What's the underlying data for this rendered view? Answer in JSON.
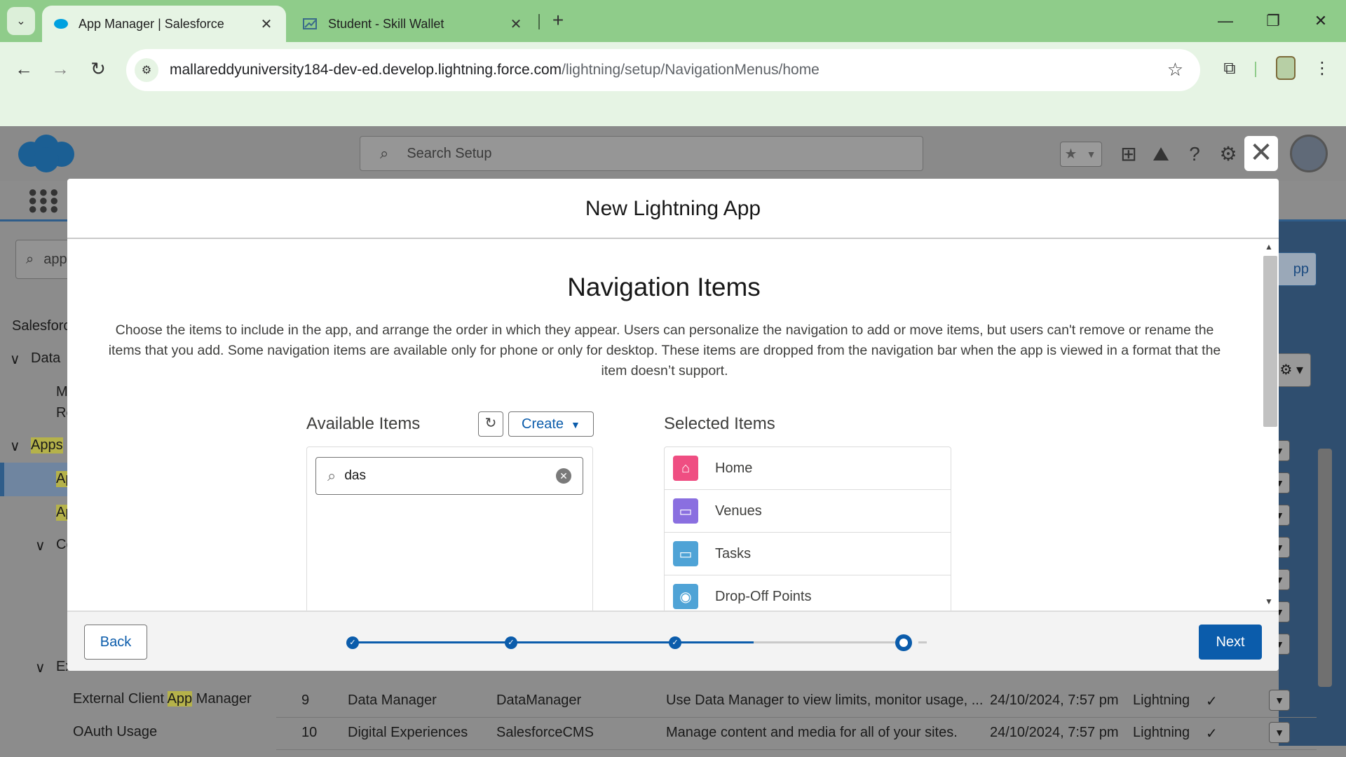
{
  "browser": {
    "tabs": [
      {
        "title": "App Manager | Salesforce",
        "active": true
      },
      {
        "title": "Student - Skill Wallet",
        "active": false
      }
    ],
    "url_host": "mallareddyuniversity184-dev-ed.develop.lightning.force.com",
    "url_path": "/lightning/setup/NavigationMenus/home"
  },
  "setup": {
    "search_placeholder": "Search Setup",
    "sidebar": {
      "search_value": "app",
      "salesforce_text": "Salesforce",
      "data_label": "Data",
      "data_sub1": "M",
      "data_sub2": "Re",
      "apps_label": "Apps",
      "apps_sub1": "Ap",
      "apps_sub2": "Ap",
      "connected_label": "Co",
      "external_label": "Ex",
      "external_client_pre": "External Client ",
      "external_client_hl": "App",
      "external_client_post": " Manager",
      "oauth_usage": "OAuth Usage"
    },
    "new_app_button_fragment": "pp",
    "table_rows": [
      {
        "num": "9",
        "label": "Data Manager",
        "dev_name": "DataManager",
        "description": "Use Data Manager to view limits, monitor usage, ...",
        "modified": "24/10/2024, 7:57 pm",
        "type": "Lightning",
        "visible": "✓"
      },
      {
        "num": "10",
        "label": "Digital Experiences",
        "dev_name": "SalesforceCMS",
        "description": "Manage content and media for all of your sites.",
        "modified": "24/10/2024, 7:57 pm",
        "type": "Lightning",
        "visible": "✓"
      }
    ]
  },
  "modal": {
    "title": "New Lightning App",
    "step_title": "Navigation Items",
    "description": "Choose the items to include in the app, and arrange the order in which they appear. Users can personalize the navigation to add or move items, but users can't remove or rename the items that you add. Some navigation items are available only for phone or only for desktop. These items are dropped from the navigation bar when the app is viewed in a format that the item doesn’t support.",
    "available_label": "Available Items",
    "create_label": "Create",
    "filter_value": "das",
    "selected_label": "Selected Items",
    "selected_items": [
      {
        "label": "Home",
        "icon": "home-icon",
        "color": "#ef4e82"
      },
      {
        "label": "Venues",
        "icon": "monitor-icon",
        "color": "#8a6fe0"
      },
      {
        "label": "Tasks",
        "icon": "laptop-icon",
        "color": "#4fa3d6"
      },
      {
        "label": "Drop-Off Points",
        "icon": "camera-icon",
        "color": "#4fa3d6"
      }
    ],
    "back_label": "Back",
    "next_label": "Next",
    "progress": {
      "total_steps": 5,
      "completed_steps": 3,
      "current_step": 4
    }
  },
  "colors": {
    "brand_blue": "#0b5cab",
    "browser_green": "#8fcc8a",
    "overlay_gray": "#8c8c8c"
  }
}
